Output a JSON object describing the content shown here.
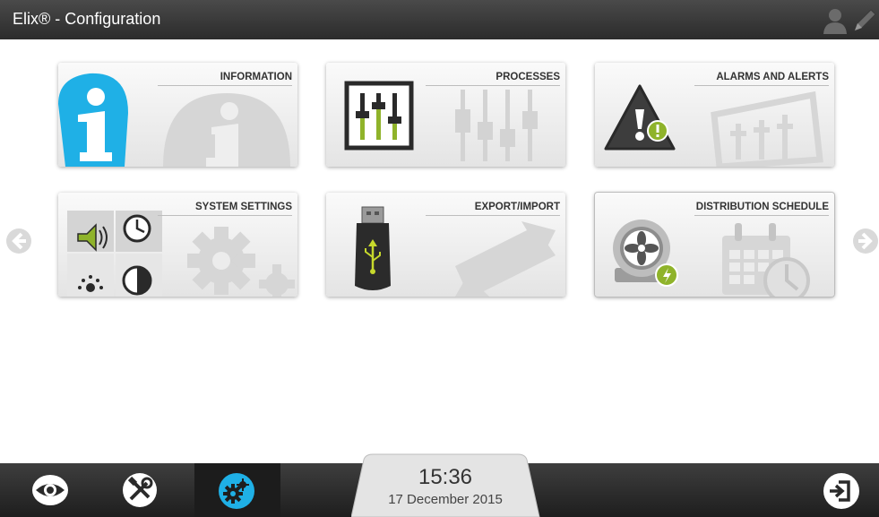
{
  "titlebar": {
    "title": "Elix® - Configuration",
    "icons": [
      "user-icon",
      "pencil-icon"
    ]
  },
  "tiles": [
    {
      "label": "INFORMATION",
      "icon": "information-icon"
    },
    {
      "label": "PROCESSES",
      "icon": "sliders-icon"
    },
    {
      "label": "ALARMS AND ALERTS",
      "icon": "warning-icon"
    },
    {
      "label": "SYSTEM SETTINGS",
      "icon": "settings-icon"
    },
    {
      "label": "EXPORT/IMPORT",
      "icon": "usb-icon"
    },
    {
      "label": "DISTRIBUTION SCHEDULE",
      "icon": "schedule-icon"
    }
  ],
  "navigation": {
    "prev_icon": "arrow-left-icon",
    "next_icon": "arrow-right-icon"
  },
  "bottombar": {
    "buttons": [
      "eye-icon",
      "tools-icon",
      "gears-icon",
      "logout-icon"
    ],
    "active": "gears-icon",
    "time": "15:36",
    "date": "17 December 2015"
  },
  "colors": {
    "accent_blue": "#1fb0e6",
    "accent_green": "#8fb32a",
    "titlebar": "#333333"
  }
}
